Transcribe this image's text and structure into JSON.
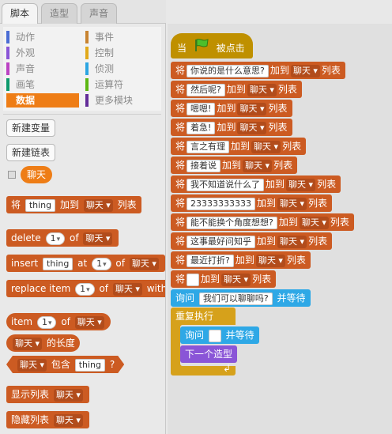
{
  "tabs": [
    "脚本",
    "造型",
    "声音"
  ],
  "categories": {
    "left": [
      {
        "label": "动作",
        "color": "#4a6cd4"
      },
      {
        "label": "外观",
        "color": "#8a55d7"
      },
      {
        "label": "声音",
        "color": "#bb42c3"
      },
      {
        "label": "画笔",
        "color": "#0e9a6c"
      },
      {
        "label": "数据",
        "color": "#ee7d16"
      }
    ],
    "right": [
      {
        "label": "事件",
        "color": "#c88330"
      },
      {
        "label": "控制",
        "color": "#e1a91a"
      },
      {
        "label": "侦测",
        "color": "#2ca5e2"
      },
      {
        "label": "运算符",
        "color": "#5cb712"
      },
      {
        "label": "更多模块",
        "color": "#632d99"
      }
    ]
  },
  "palette": {
    "new_variable": "新建变量",
    "new_list": "新建链表",
    "list_name": "聊天",
    "add": {
      "prefix": "将",
      "value": "thing",
      "middle": "加到",
      "list": "聊天",
      "suffix": "列表"
    },
    "delete": {
      "label": "delete",
      "index": "1",
      "of": "of",
      "list": "聊天"
    },
    "insert": {
      "label": "insert",
      "value": "thing",
      "at": "at",
      "index": "1",
      "of": "of",
      "list": "聊天"
    },
    "replace": {
      "label": "replace item",
      "index": "1",
      "of": "of",
      "list": "聊天",
      "with": "with"
    },
    "item": {
      "label": "item",
      "index": "1",
      "of": "of",
      "list": "聊天"
    },
    "length": {
      "list": "聊天",
      "label": "的长度"
    },
    "contains": {
      "list": "聊天",
      "label": "包含",
      "value": "thing",
      "q": "?"
    },
    "show": {
      "label": "显示列表",
      "list": "聊天"
    },
    "hide": {
      "label": "隐藏列表",
      "list": "聊天"
    }
  },
  "script": {
    "hat": {
      "when": "当",
      "clicked": "被点击"
    },
    "add_prefix": "将",
    "add_middle": "加到",
    "add_suffix": "列表",
    "list": "聊天",
    "items": [
      "你说的是什么意思?",
      "然后呢?",
      "嗯嗯!",
      "着急!",
      "言之有理",
      "接着说",
      "我不知道说什么了",
      "23333333333",
      "能不能换个角度想想?",
      "这事最好问知乎",
      "最近打折?",
      ""
    ],
    "ask": {
      "label": "询问",
      "question": "我们可以聊聊吗?",
      "wait": "并等待"
    },
    "forever": "重复执行",
    "ask2": {
      "label": "询问",
      "question": "",
      "wait": "并等待"
    },
    "next_costume": "下一个造型"
  }
}
